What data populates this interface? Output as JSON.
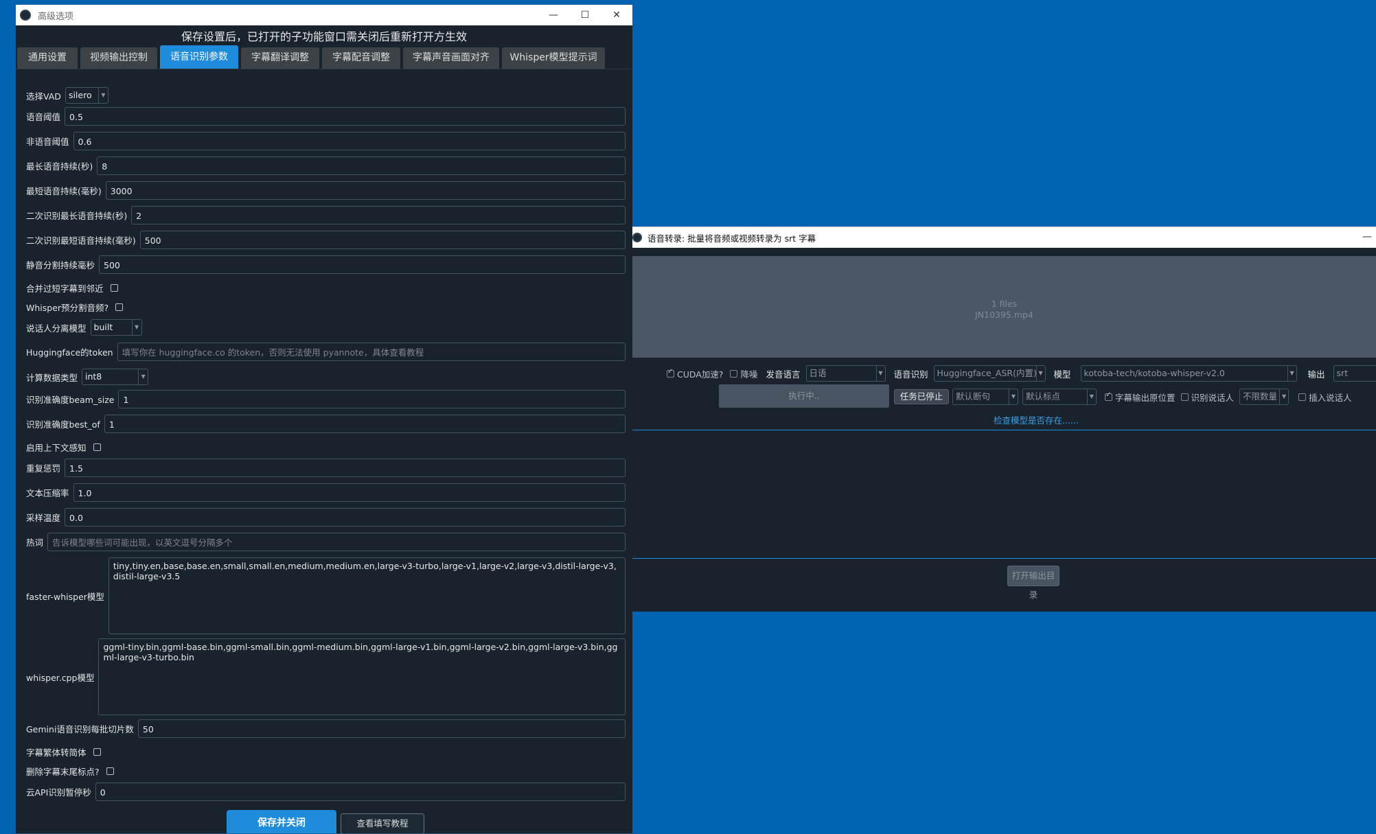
{
  "win1": {
    "title": "高级选项",
    "controls": {
      "minimize": "—",
      "maximize": "☐",
      "close": "✕"
    },
    "notice": "保存设置后，已打开的子功能窗口需关闭后重新打开方生效",
    "tabs": [
      "通用设置",
      "视频输出控制",
      "语音识别参数",
      "字幕翻译调整",
      "字幕配音调整",
      "字幕声音画面对齐",
      "Whisper模型提示词"
    ],
    "active_tab": "语音识别参数",
    "fields": {
      "vad": {
        "label": "选择VAD",
        "value": "silero"
      },
      "speech_threshold": {
        "label": "语音阈值",
        "value": "0.5"
      },
      "non_speech_threshold": {
        "label": "非语音阈值",
        "value": "0.6"
      },
      "max_speech": {
        "label": "最长语音持续(秒)",
        "value": "8"
      },
      "min_speech": {
        "label": "最短语音持续(毫秒)",
        "value": "3000"
      },
      "second_max": {
        "label": "二次识别最长语音持续(秒)",
        "value": "2"
      },
      "second_min": {
        "label": "二次识别最短语音持续(毫秒)",
        "value": "500"
      },
      "silence_split": {
        "label": "静音分割持续毫秒",
        "value": "500"
      },
      "merge_short": {
        "label": "合并过短字幕到邻近"
      },
      "whisper_presplit": {
        "label": "Whisper预分割音频?"
      },
      "diarize_model": {
        "label": "说话人分离模型",
        "value": "built"
      },
      "hf_token": {
        "label": "Huggingface的token",
        "placeholder": "填写你在 huggingface.co 的token，否则无法使用 pyannote，具体查看教程"
      },
      "compute_type": {
        "label": "计算数据类型",
        "value": "int8"
      },
      "beam_size": {
        "label": "识别准确度beam_size",
        "value": "1"
      },
      "best_of": {
        "label": "识别准确度best_of",
        "value": "1"
      },
      "context_aware": {
        "label": "启用上下文感知"
      },
      "repetition_penalty": {
        "label": "重复惩罚",
        "value": "1.5"
      },
      "compression_ratio": {
        "label": "文本压缩率",
        "value": "1.0"
      },
      "temperature": {
        "label": "采样温度",
        "value": "0.0"
      },
      "hotwords": {
        "label": "热词",
        "placeholder": "告诉模型哪些词可能出现，以英文逗号分隔多个"
      },
      "faster_whisper_models": {
        "label": "faster-whisper模型",
        "value": "tiny,tiny.en,base,base.en,small,small.en,medium,medium.en,large-v3-turbo,large-v1,large-v2,large-v3,distil-large-v3,distil-large-v3.5"
      },
      "whisper_cpp_models": {
        "label": "whisper.cpp模型",
        "value": "ggml-tiny.bin,ggml-base.bin,ggml-small.bin,ggml-medium.bin,ggml-large-v1.bin,ggml-large-v2.bin,ggml-large-v3.bin,ggml-large-v3-turbo.bin"
      },
      "gemini_batch": {
        "label": "Gemini语音识别每批切片数",
        "value": "50"
      },
      "trad_to_simp": {
        "label": "字幕繁体转简体"
      },
      "remove_trailing_punct": {
        "label": "删除字幕末尾标点?"
      },
      "cloud_api_pause": {
        "label": "云API识别暂停秒",
        "value": "0"
      }
    },
    "buttons": {
      "save_close": "保存并关闭",
      "view_tutorial": "查看填写教程"
    }
  },
  "win2": {
    "title": "语音转录: 批量将音频或视频转录为 srt 字幕",
    "minimize": "—",
    "dropzone": {
      "count": "1 files",
      "filename": "JN10395.mp4"
    },
    "cuda": {
      "label": "CUDA加速?",
      "checked": true
    },
    "denoise": {
      "label": "降噪",
      "checked": false
    },
    "source_lang": {
      "label": "发音语言",
      "value": "日语"
    },
    "asr": {
      "label": "语音识别",
      "value": "Huggingface_ASR(内置)"
    },
    "model": {
      "label": "模型",
      "value": "kotoba-tech/kotoba-whisper-v2.0"
    },
    "output": {
      "label": "输出",
      "value": "srt"
    },
    "run_button": "执行中..",
    "stop_button": "任务已停止",
    "split_mode": "默认断句",
    "punct_mode": "默认标点",
    "keep_position": {
      "label": "字幕输出原位置",
      "checked": true
    },
    "recognize_speaker": {
      "label": "识别说话人",
      "checked": false
    },
    "speaker_count": "不限数量",
    "insert_speaker": {
      "label": "插入说话人",
      "checked": false
    },
    "check_model_link": "检查模型是否存在......",
    "open_output_button": "打开输出目录"
  }
}
